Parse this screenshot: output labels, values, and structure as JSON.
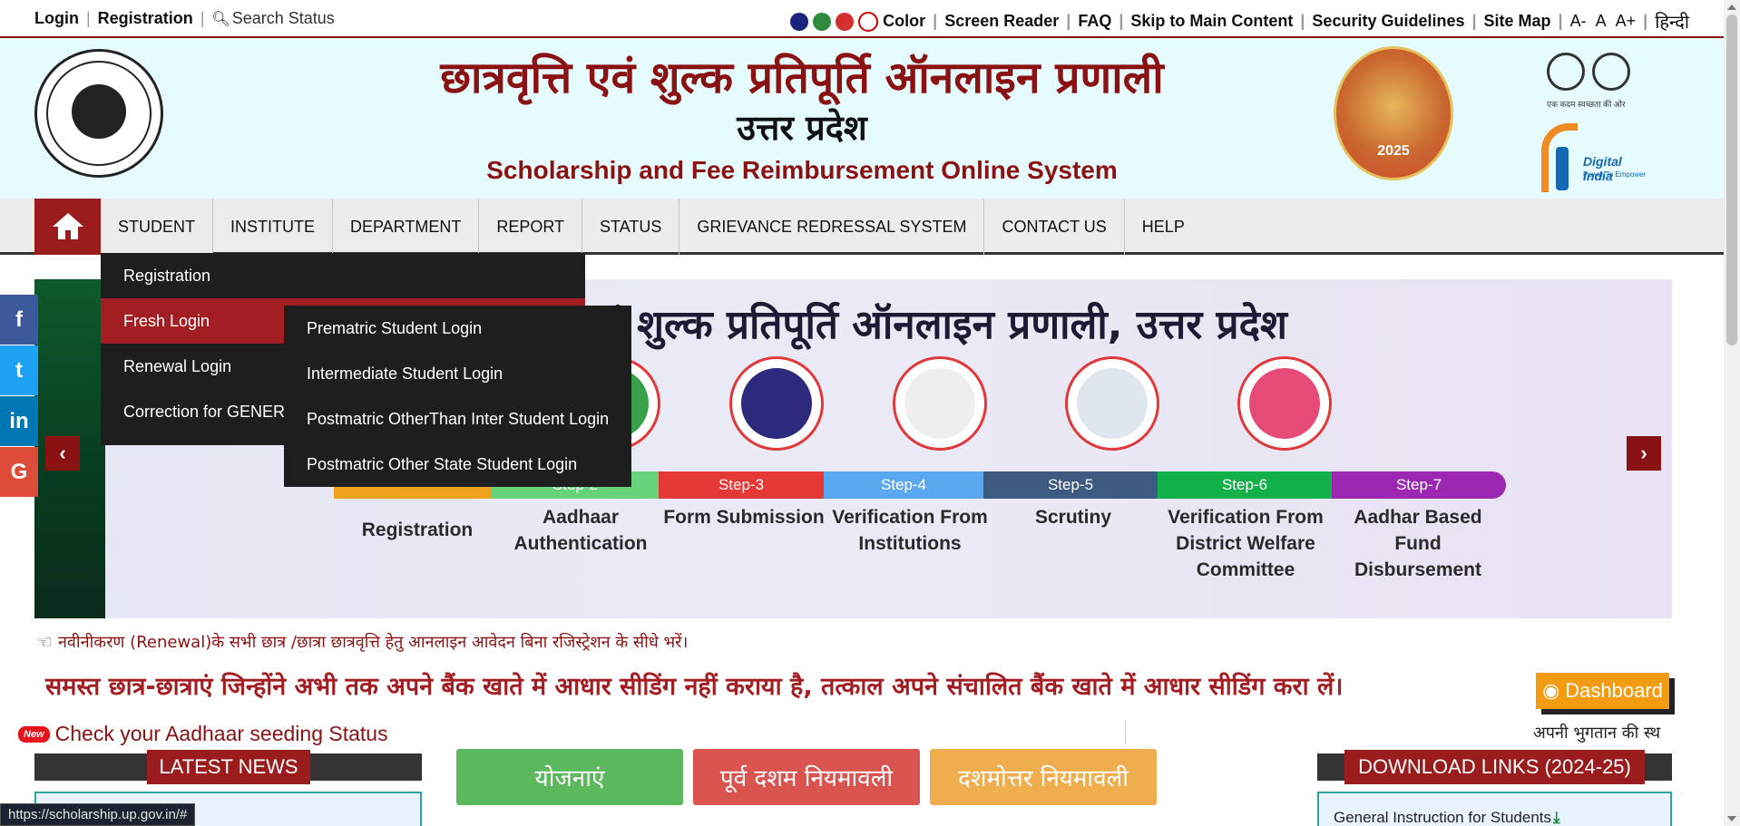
{
  "topbar": {
    "login": "Login",
    "registration": "Registration",
    "search": "Search Status",
    "color": "Color",
    "screen_reader": "Screen Reader",
    "faq": "FAQ",
    "skip": "Skip to Main Content",
    "security": "Security Guidelines",
    "sitemap": "Site Map",
    "font_minus": "A-",
    "font_normal": "A",
    "font_plus": "A+",
    "hindi": "हिन्दी",
    "dot_colors": [
      "#1a237e",
      "#2e8b3e",
      "#d32f2f",
      "#ffffff"
    ]
  },
  "header": {
    "title_hindi": "छात्रवृत्ति एवं शुल्क प्रतिपूर्ति ऑनलाइन प्रणाली",
    "subtitle_hindi": "उत्तर प्रदेश",
    "title_english": "Scholarship and Fee Reimbursement Online System",
    "kumbh_year": "2025",
    "swachh_text": "एक कदम स्वच्छता की ओर",
    "digital_india": "Digital India",
    "digital_india_tag": "Power To Empower"
  },
  "nav": {
    "items": [
      "STUDENT",
      "INSTITUTE",
      "DEPARTMENT",
      "REPORT",
      "STATUS",
      "GRIEVANCE REDRESSAL SYSTEM",
      "CONTACT US",
      "HELP"
    ]
  },
  "dropdown": {
    "items": [
      "Registration",
      "Fresh Login",
      "Renewal Login",
      "Correction for GENERAL"
    ],
    "submenu": [
      "Prematric Student Login",
      "Intermediate Student Login",
      "Postmatric OtherThan Inter Student Login",
      "Postmatric Other State Student Login"
    ]
  },
  "slider": {
    "title": "एवं शुल्क प्रतिपूर्ति ऑनलाइन प्रणाली, उत्तर प्रदेश",
    "steps": [
      {
        "tag": "",
        "label": "Registration",
        "color": "#f0a21c"
      },
      {
        "tag": "Step-2",
        "label": "Aadhaar Authentication",
        "color": "#66d27a"
      },
      {
        "tag": "Step-3",
        "label": "Form Submission",
        "color": "#e53935"
      },
      {
        "tag": "Step-4",
        "label": "Verification From Institutions",
        "color": "#5aa8f0"
      },
      {
        "tag": "Step-5",
        "label": "Scrutiny",
        "color": "#3d5a80"
      },
      {
        "tag": "Step-6",
        "label": "Verification From District Welfare Committee",
        "color": "#12b04a"
      },
      {
        "tag": "Step-7",
        "label": "Aadhar Based Fund Disbursement",
        "color": "#9c27b0"
      }
    ],
    "prev": "‹",
    "next": "›"
  },
  "social": [
    {
      "icon": "f",
      "color": "#3b5998"
    },
    {
      "icon": "t",
      "color": "#1da1f2"
    },
    {
      "icon": "in",
      "color": "#0077b5"
    },
    {
      "icon": "G",
      "color": "#dd4b39"
    }
  ],
  "notices": {
    "renewal": "नवीनीकरण (Renewal)के सभी छात्र /छात्रा छात्रवृत्ति हेतु आनलाइन आवेदन बिना रजिस्ट्रेशन के सीधे भरें।",
    "aadhaar_seeding": "समस्त छात्र-छात्राएं जिन्होंने अभी तक अपने बैंक खाते में आधार सीडिंग नहीं कराया है, तत्काल अपने संचालित बैंक खाते में आधार सीडिंग करा लें।",
    "new_badge": "New",
    "check_aadhaar": "Check your Aadhaar seeding Status",
    "dashboard": "Dashboard",
    "apni": "अपनी भुगतान की स्थ"
  },
  "panels": {
    "latest_news": "LATEST NEWS",
    "download_links": "DOWNLOAD LINKS (2024-25)",
    "general_instruction": "General Instruction for Students"
  },
  "buttons": {
    "yojanayein": "योजनाएं",
    "purv_dasham": "पूर्व दशम नियमावली",
    "dashmottar": "दशमोत्तर नियमावली"
  },
  "status_url": "https://scholarship.up.gov.in/#"
}
